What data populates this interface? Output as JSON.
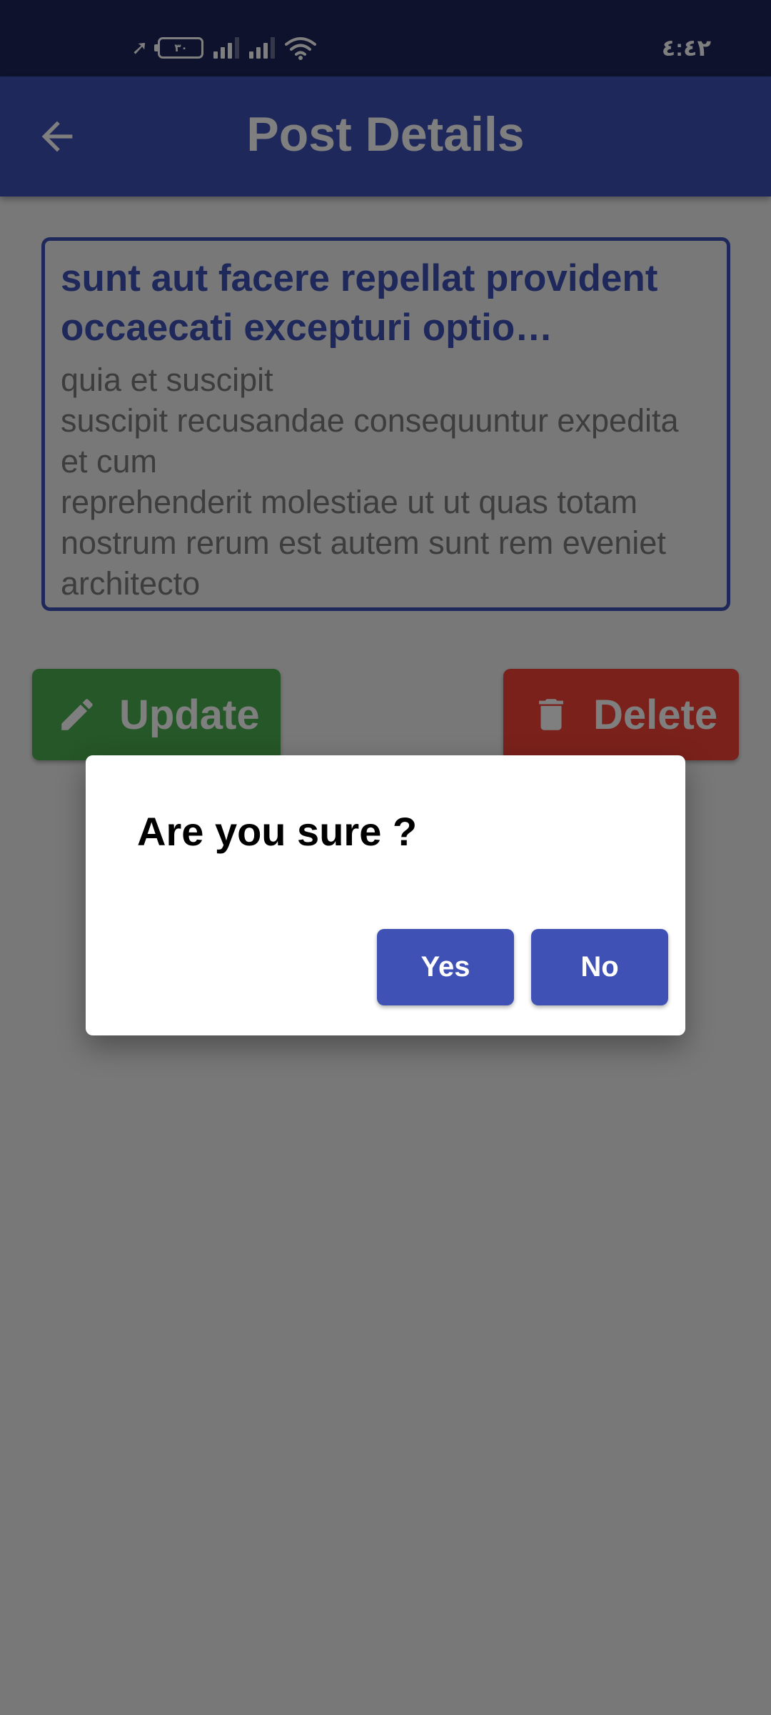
{
  "status_bar": {
    "battery_level": "٣٠",
    "time": "٤:٤٢"
  },
  "app_bar": {
    "title": "Post Details",
    "back_icon": "arrow-left-icon"
  },
  "post": {
    "title": "sunt aut facere repellat provident occaecati excepturi optio reprehenderit",
    "body": "quia et suscipit\nsuscipit recusandae consequuntur expedita et cum\nreprehenderit molestiae ut ut quas totam\nnostrum rerum est autem sunt rem eveniet architecto"
  },
  "actions": {
    "update_label": "Update",
    "update_icon": "pencil-icon",
    "update_color": "#4caf50",
    "delete_label": "Delete",
    "delete_icon": "trash-icon",
    "delete_color": "#f44336"
  },
  "dialog": {
    "title": "Are you sure ?",
    "yes_label": "Yes",
    "no_label": "No"
  },
  "colors": {
    "primary": "#3f51b5",
    "status_bar": "#1c2458",
    "scrim_opacity": 0.5
  }
}
